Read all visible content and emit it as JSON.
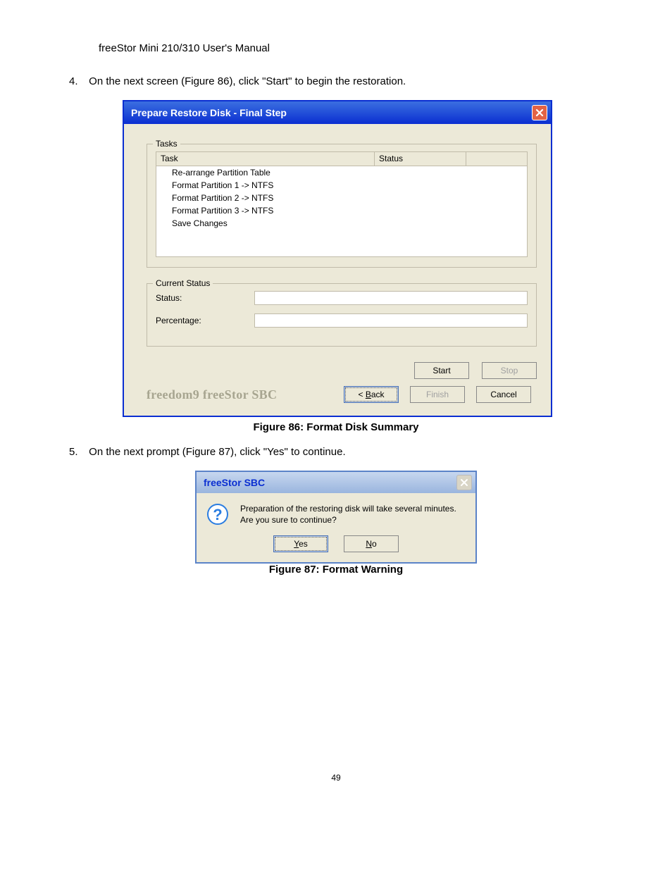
{
  "header_text": "freeStor Mini 210/310 User's Manual",
  "step4_num": "4.",
  "step4_text": "On the next screen (Figure 86), click \"Start\" to begin the restoration.",
  "figure86_caption": "Figure 86: Format Disk Summary",
  "step5_num": "5.",
  "step5_text": "On the next prompt (Figure 87), click \"Yes\" to continue.",
  "figure87_caption": "Figure 87: Format Warning",
  "page_number": "49",
  "dialog1": {
    "title": "Prepare Restore Disk - Final Step",
    "tasks_legend": "Tasks",
    "col_task": "Task",
    "col_status": "Status",
    "rows": [
      "Re-arrange Partition Table",
      "Format Partition 1 -> NTFS",
      "Format Partition 2 -> NTFS",
      "Format Partition 3 -> NTFS",
      "Save Changes"
    ],
    "current_status_legend": "Current Status",
    "status_label": "Status:",
    "percentage_label": "Percentage:",
    "start_btn": "Start",
    "stop_btn": "Stop",
    "brand": "freedom9 freeStor SBC",
    "back_prefix": "< ",
    "back_letter": "B",
    "back_suffix": "ack",
    "finish_btn": "Finish",
    "cancel_btn": "Cancel"
  },
  "dialog2": {
    "title": "freeStor SBC",
    "msg_line1": "Preparation of the restoring disk will take several minutes.",
    "msg_line2": "Are you sure to continue?",
    "yes_letter": "Y",
    "yes_suffix": "es",
    "no_letter": "N",
    "no_suffix": "o"
  }
}
